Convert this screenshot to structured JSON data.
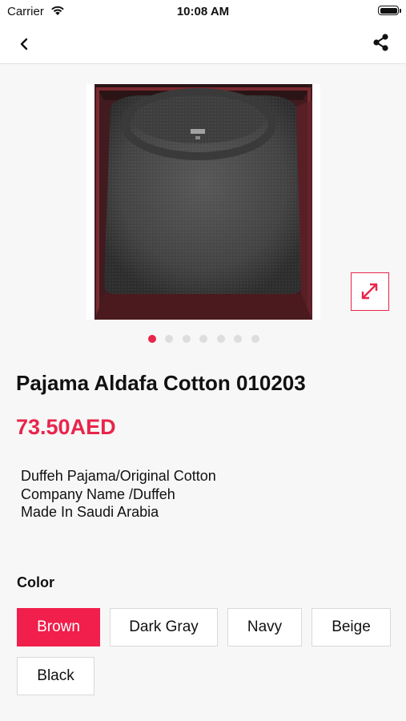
{
  "status_bar": {
    "carrier": "Carrier",
    "time": "10:08 AM"
  },
  "nav": {
    "back_icon": "chevron-left-icon",
    "share_icon": "share-icon"
  },
  "gallery": {
    "image_subject": "dark gray cotton pajama in box",
    "total_images": 7,
    "active_index": 0,
    "expand_icon": "expand-icon"
  },
  "product": {
    "title": "Pajama Aldafa Cotton 010203",
    "price": "73.50AED",
    "description_lines": [
      "Duffeh Pajama/Original Cotton",
      "Company Name /Duffeh",
      "Made In Saudi Arabia"
    ]
  },
  "color": {
    "label": "Color",
    "options": [
      "Brown",
      "Dark Gray",
      "Navy",
      "Beige",
      "Black"
    ],
    "selected": "Brown"
  },
  "colors": {
    "accent": "#e8254b",
    "selected_swatch": "#f01f4b"
  }
}
